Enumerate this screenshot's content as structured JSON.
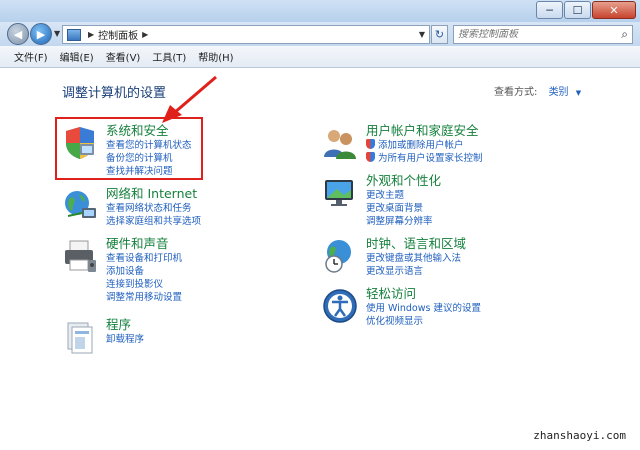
{
  "window": {
    "minimize": "─",
    "maximize": "☐",
    "close": "✕"
  },
  "address": {
    "breadcrumb": "控制面板",
    "search_placeholder": "搜索控制面板"
  },
  "menu": [
    "文件(F)",
    "编辑(E)",
    "查看(V)",
    "工具(T)",
    "帮助(H)"
  ],
  "page": {
    "title": "调整计算机的设置",
    "view_by_label": "查看方式:",
    "view_by_value": "类别"
  },
  "categories": {
    "system": {
      "title": "系统和安全",
      "links": [
        "查看您的计算机状态",
        "备份您的计算机",
        "查找并解决问题"
      ]
    },
    "network": {
      "title": "网络和 Internet",
      "links": [
        "查看网络状态和任务",
        "选择家庭组和共享选项"
      ]
    },
    "hardware": {
      "title": "硬件和声音",
      "links": [
        "查看设备和打印机",
        "添加设备",
        "连接到投影仪",
        "调整常用移动设置"
      ]
    },
    "programs": {
      "title": "程序",
      "links": [
        "卸载程序"
      ]
    },
    "users": {
      "title": "用户帐户和家庭安全",
      "links": [
        "添加或删除用户帐户",
        "为所有用户设置家长控制"
      ]
    },
    "appearance": {
      "title": "外观和个性化",
      "links": [
        "更改主题",
        "更改桌面背景",
        "调整屏幕分辨率"
      ]
    },
    "clock": {
      "title": "时钟、语言和区域",
      "links": [
        "更改键盘或其他输入法",
        "更改显示语言"
      ]
    },
    "ease": {
      "title": "轻松访问",
      "links": [
        "使用 Windows 建议的设置",
        "优化视频显示"
      ]
    }
  },
  "watermark": "zhanshaoyi.com",
  "colors": {
    "category_title": "#15803d",
    "link": "#1f5fbf",
    "page_title": "#1a3f7a",
    "highlight": "#e0201a"
  }
}
